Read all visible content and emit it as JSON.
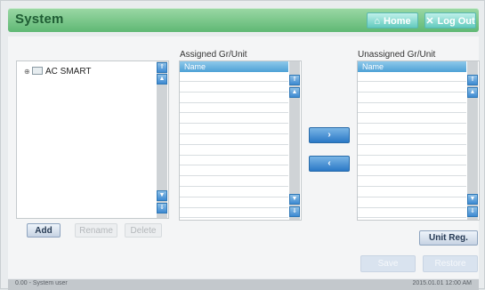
{
  "header": {
    "title": "System",
    "home_label": "Home",
    "logout_label": "Log Out",
    "home_icon": "home-icon",
    "logout_icon": "close-icon"
  },
  "tree": {
    "items": [
      {
        "label": "AC SMART",
        "expander": "⊕"
      }
    ]
  },
  "assigned": {
    "label": "Assigned Gr/Unit",
    "column": "Name",
    "rows": [
      "",
      "",
      "",
      "",
      "",
      "",
      "",
      "",
      "",
      "",
      "",
      "",
      "",
      ""
    ]
  },
  "unassigned": {
    "label": "Unassigned Gr/Unit",
    "column": "Name",
    "rows": [
      "",
      "",
      "",
      "",
      "",
      "",
      "",
      "",
      "",
      "",
      "",
      "",
      "",
      ""
    ]
  },
  "buttons": {
    "add": "Add",
    "rename": "Rename",
    "delete": "Delete",
    "assign": "›",
    "unassign": "‹",
    "unit_reg": "Unit Reg.",
    "save": "Save",
    "restore": "Restore"
  },
  "status": {
    "left": "0.00 - System user",
    "right": "2015.01.01 12:00 AM"
  },
  "colors": {
    "title_bar": "#5fb874",
    "header_buttons": "#63cbbf",
    "list_header": "#4ea1d6",
    "arrow_buttons": "#2b78c6"
  }
}
